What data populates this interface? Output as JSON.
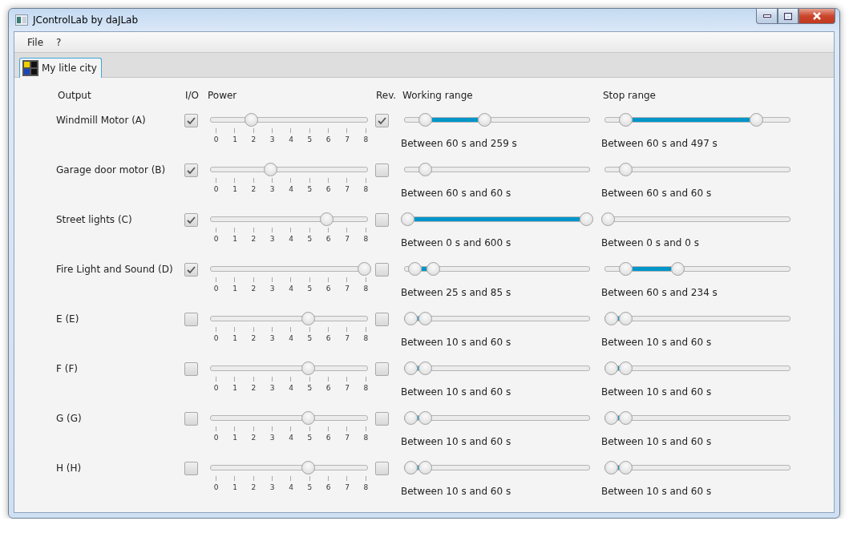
{
  "window": {
    "title": "JControlLab by daJLab"
  },
  "menu": [
    {
      "label": "File"
    },
    {
      "label": "?"
    }
  ],
  "tabs": [
    {
      "label": "My litle city",
      "selected": true
    }
  ],
  "columns": [
    "Output",
    "I/O",
    "Power",
    "Rev.",
    "Working range",
    "Stop range"
  ],
  "rows": [
    {
      "name": "Windmill Motor (A)",
      "enabled": true,
      "power": {
        "level": 0.25,
        "ticks": [
          "0",
          "1",
          "2",
          "3",
          "4",
          "5",
          "6",
          "7",
          "8"
        ]
      },
      "reversed": true,
      "working": {
        "thumbs": [
          {
            "level": 0.1
          },
          {
            "level": 0.43
          }
        ],
        "text": "Between 60 s and 259 s"
      },
      "stop": {
        "thumbs": [
          {
            "level": 0.1
          },
          {
            "level": 0.83
          }
        ],
        "text": "Between 60 s and 497 s"
      }
    },
    {
      "name": "Garage door motor (B)",
      "enabled": true,
      "power": {
        "level": 0.38,
        "ticks": [
          "0",
          "1",
          "2",
          "3",
          "4",
          "5",
          "6",
          "7",
          "8"
        ]
      },
      "reversed": false,
      "working": {
        "thumbs": [
          {
            "level": 0.1
          },
          {
            "level": 0.1
          }
        ],
        "text": "Between 60 s and 60 s"
      },
      "stop": {
        "thumbs": [
          {
            "level": 0.1
          },
          {
            "level": 0.1
          }
        ],
        "text": "Between 60 s and 60 s"
      }
    },
    {
      "name": "Street lights (C)",
      "enabled": true,
      "power": {
        "level": 0.75,
        "ticks": [
          "0",
          "1",
          "2",
          "3",
          "4",
          "5",
          "6",
          "7",
          "8"
        ]
      },
      "reversed": false,
      "working": {
        "thumbs": [
          {
            "level": 0
          },
          {
            "level": 1
          }
        ],
        "text": "Between 0 s and 600 s"
      },
      "stop": {
        "thumbs": [
          {
            "level": 0
          },
          {
            "level": 0
          }
        ],
        "text": "Between 0 s and 0 s"
      }
    },
    {
      "name": "Fire Light and Sound (D)",
      "enabled": true,
      "power": {
        "level": 1,
        "ticks": [
          "0",
          "1",
          "2",
          "3",
          "4",
          "5",
          "6",
          "7",
          "8"
        ]
      },
      "reversed": false,
      "working": {
        "thumbs": [
          {
            "level": 0.042
          },
          {
            "level": 0.142
          }
        ],
        "text": "Between 25 s and 85 s"
      },
      "stop": {
        "thumbs": [
          {
            "level": 0.1
          },
          {
            "level": 0.39
          }
        ],
        "text": "Between 60 s and 234 s"
      }
    },
    {
      "name": "E (E)",
      "enabled": false,
      "power": {
        "level": 0.625,
        "ticks": [
          "0",
          "1",
          "2",
          "3",
          "4",
          "5",
          "6",
          "7",
          "8"
        ]
      },
      "reversed": false,
      "working": {
        "thumbs": [
          {
            "level": 0.017
          },
          {
            "level": 0.1
          }
        ],
        "text": "Between 10 s and 60 s"
      },
      "stop": {
        "thumbs": [
          {
            "level": 0.017
          },
          {
            "level": 0.1
          }
        ],
        "text": "Between 10 s and 60 s"
      }
    },
    {
      "name": "F (F)",
      "enabled": false,
      "power": {
        "level": 0.625,
        "ticks": [
          "0",
          "1",
          "2",
          "3",
          "4",
          "5",
          "6",
          "7",
          "8"
        ]
      },
      "reversed": false,
      "working": {
        "thumbs": [
          {
            "level": 0.017
          },
          {
            "level": 0.1
          }
        ],
        "text": "Between 10 s and 60 s"
      },
      "stop": {
        "thumbs": [
          {
            "level": 0.017
          },
          {
            "level": 0.1
          }
        ],
        "text": "Between 10 s and 60 s"
      }
    },
    {
      "name": "G (G)",
      "enabled": false,
      "power": {
        "level": 0.625,
        "ticks": [
          "0",
          "1",
          "2",
          "3",
          "4",
          "5",
          "6",
          "7",
          "8"
        ]
      },
      "reversed": false,
      "working": {
        "thumbs": [
          {
            "level": 0.017
          },
          {
            "level": 0.1
          }
        ],
        "text": "Between 10 s and 60 s"
      },
      "stop": {
        "thumbs": [
          {
            "level": 0.017
          },
          {
            "level": 0.1
          }
        ],
        "text": "Between 10 s and 60 s"
      }
    },
    {
      "name": "H (H)",
      "enabled": false,
      "power": {
        "level": 0.625,
        "ticks": [
          "0",
          "1",
          "2",
          "3",
          "4",
          "5",
          "6",
          "7",
          "8"
        ]
      },
      "reversed": false,
      "working": {
        "thumbs": [
          {
            "level": 0.017
          },
          {
            "level": 0.1
          }
        ],
        "text": "Between 10 s and 60 s"
      },
      "stop": {
        "thumbs": [
          {
            "level": 0.017
          },
          {
            "level": 0.1
          }
        ],
        "text": "Between 10 s and 60 s"
      }
    }
  ]
}
